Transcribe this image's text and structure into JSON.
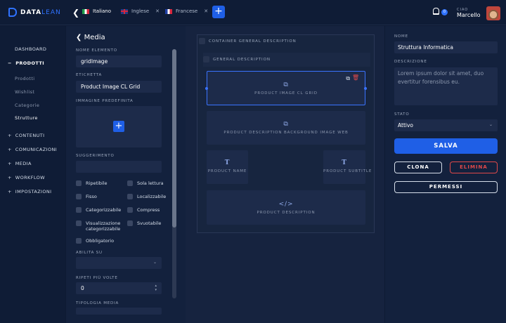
{
  "app": {
    "logo_prefix": "DATA",
    "logo_suffix": "LEAN"
  },
  "languages": [
    {
      "label": "Italiano",
      "flag": "italy-flag"
    },
    {
      "label": "Inglese",
      "flag": "uk-flag"
    },
    {
      "label": "Francese",
      "flag": "france-flag"
    }
  ],
  "topbar": {
    "notifications": "0",
    "greeting": "CIAO",
    "user": "Marcello"
  },
  "sidebar": {
    "dashboard": "DASHBOARD",
    "prodotti": "PRODOTTI",
    "prodotti_sub": [
      "Prodotti",
      "Wishlist",
      "Categorie",
      "Strutture"
    ],
    "contenuti": "CONTENUTI",
    "comunicazioni": "COMUNICAZIONI",
    "media": "MEDIA",
    "workflow": "WORKFLOW",
    "impostazioni": "IMPOSTAZIONI"
  },
  "form": {
    "title": "Media",
    "nome_label": "NOME ELEMENTO",
    "nome_value": "gridImage",
    "etichetta_label": "ETICHETTA",
    "etichetta_value": "Product Image CL Grid",
    "immagine_label": "IMMAGINE PREDEFINITA",
    "suggerimento_label": "SUGGERIMENTO",
    "checks": [
      "Ripetibile",
      "Sola lettura",
      "Fisso",
      "Localizzabile",
      "Categorizzabile",
      "Compress",
      "Visualizzazione categorizzabile",
      "Svuotabile",
      "Obbligatorio"
    ],
    "abilita_label": "ABILITA SU",
    "ripeti_label": "RIPETI PIÙ VOLTE",
    "ripeti_value": "0",
    "tipologia_label": "TIPOLOGIA MEDIA"
  },
  "canvas": {
    "container": "CONTAINER GENERAL DESCRIPTION",
    "general": "GENERAL DESCRIPTION",
    "image_grid": "PRODUCT IMAGE CL GRID",
    "bg_image": "PRODUCT DESCRIPTION BACKGROUND IMAGE WEB",
    "name": "PRODUCT NAME",
    "subtitle": "PRODUCT SUBTITLE",
    "description": "PRODUCT DESCRIPTION"
  },
  "right": {
    "nome_label": "NOME",
    "nome_value": "Struttura Informatica",
    "desc_label": "DESCRIZIONE",
    "desc_value": "Lorem ipsum dolor sit amet, duo evertitur forensibus eu.",
    "stato_label": "STATO",
    "stato_value": "Attivo",
    "salva": "SALVA",
    "clona": "CLONA",
    "elimina": "ELIMINA",
    "permessi": "PERMESSI"
  },
  "colors": {
    "accent": "#1f5fe6",
    "danger": "#e0494a",
    "bg": "#0e1a33"
  }
}
